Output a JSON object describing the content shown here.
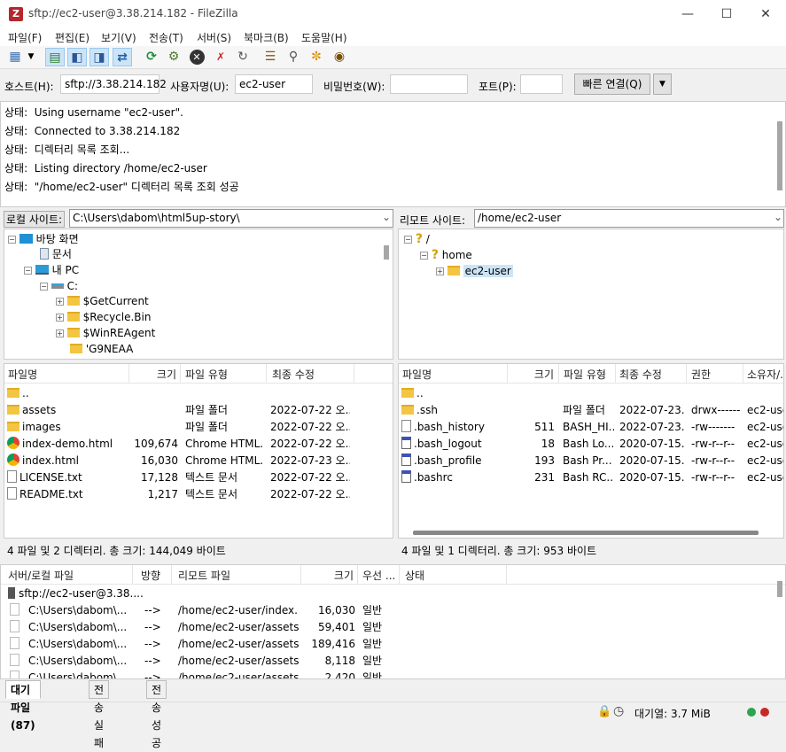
{
  "window": {
    "title": "sftp://ec2-user@3.38.214.182 - FileZilla",
    "app_icon": "Z"
  },
  "menu": [
    "파일(F)",
    "편집(E)",
    "보기(V)",
    "전송(T)",
    "서버(S)",
    "북마크(B)",
    "도움말(H)"
  ],
  "quickconnect": {
    "host_label": "호스트(H):",
    "host_value": "sftp://3.38.214.182",
    "user_label": "사용자명(U):",
    "user_value": "ec2-user",
    "pass_label": "비밀번호(W):",
    "pass_value": "",
    "port_label": "포트(P):",
    "port_value": "",
    "connect_label": "빠른 연결(Q)"
  },
  "log": [
    {
      "prefix": "상태:",
      "text": "Using username \"ec2-user\"."
    },
    {
      "prefix": "상태:",
      "text": "Connected to 3.38.214.182"
    },
    {
      "prefix": "상태:",
      "text": "디렉터리 목록 조회..."
    },
    {
      "prefix": "상태:",
      "text": "Listing directory /home/ec2-user"
    },
    {
      "prefix": "상태:",
      "text": "\"/home/ec2-user\" 디렉터리 목록 조회 성공"
    }
  ],
  "local": {
    "site_label": "로컬 사이트:",
    "site_path": "C:\\Users\\dabom\\html5up-story\\",
    "tree": [
      {
        "label": "바탕 화면",
        "icon": "desktop-icon"
      },
      {
        "label": "문서",
        "icon": "document-icon"
      },
      {
        "label": "내 PC",
        "icon": "computer-icon"
      },
      {
        "label": "C:",
        "icon": "drive-icon"
      },
      {
        "label": "$GetCurrent",
        "icon": "folder-icon"
      },
      {
        "label": "$Recycle.Bin",
        "icon": "folder-icon"
      },
      {
        "label": "$WinREAgent",
        "icon": "folder-icon"
      },
      {
        "label": "'G9NEAA",
        "icon": "folder-icon"
      }
    ],
    "columns": [
      "파일명",
      "크기",
      "파일 유형",
      "최종 수정"
    ],
    "files": [
      {
        "name": "..",
        "size": "",
        "type": "",
        "modified": "",
        "icon": "folder"
      },
      {
        "name": "assets",
        "size": "",
        "type": "파일 폴더",
        "modified": "2022-07-22 오...",
        "icon": "folder"
      },
      {
        "name": "images",
        "size": "",
        "type": "파일 폴더",
        "modified": "2022-07-22 오...",
        "icon": "folder"
      },
      {
        "name": "index-demo.html",
        "size": "109,674",
        "type": "Chrome HTML...",
        "modified": "2022-07-22 오...",
        "icon": "chrome"
      },
      {
        "name": "index.html",
        "size": "16,030",
        "type": "Chrome HTML...",
        "modified": "2022-07-23 오...",
        "icon": "chrome"
      },
      {
        "name": "LICENSE.txt",
        "size": "17,128",
        "type": "텍스트 문서",
        "modified": "2022-07-22 오...",
        "icon": "text"
      },
      {
        "name": "README.txt",
        "size": "1,217",
        "type": "텍스트 문서",
        "modified": "2022-07-22 오...",
        "icon": "text"
      }
    ],
    "status": "4 파일 및 2 디렉터리. 총 크기: 144,049 바이트"
  },
  "remote": {
    "site_label": "리모트 사이트:",
    "site_path": "/home/ec2-user",
    "tree": [
      {
        "label": "/",
        "icon": "question-icon"
      },
      {
        "label": "home",
        "icon": "question-icon"
      },
      {
        "label": "ec2-user",
        "icon": "folder-icon"
      }
    ],
    "columns": [
      "파일명",
      "크기",
      "파일 유형",
      "최종 수정",
      "권한",
      "소유자/..."
    ],
    "files": [
      {
        "name": "..",
        "size": "",
        "type": "",
        "modified": "",
        "perm": "",
        "owner": "",
        "icon": "folder"
      },
      {
        "name": ".ssh",
        "size": "",
        "type": "파일 폴더",
        "modified": "2022-07-23...",
        "perm": "drwx------",
        "owner": "ec2-user",
        "icon": "folder"
      },
      {
        "name": ".bash_history",
        "size": "511",
        "type": "BASH_HI...",
        "modified": "2022-07-23...",
        "perm": "-rw-------",
        "owner": "ec2-user",
        "icon": "text"
      },
      {
        "name": ".bash_logout",
        "size": "18",
        "type": "Bash Lo...",
        "modified": "2020-07-15...",
        "perm": "-rw-r--r--",
        "owner": "ec2-user",
        "icon": "script"
      },
      {
        "name": ".bash_profile",
        "size": "193",
        "type": "Bash Pr...",
        "modified": "2020-07-15...",
        "perm": "-rw-r--r--",
        "owner": "ec2-user",
        "icon": "script"
      },
      {
        "name": ".bashrc",
        "size": "231",
        "type": "Bash RC...",
        "modified": "2020-07-15...",
        "perm": "-rw-r--r--",
        "owner": "ec2-user",
        "icon": "script"
      }
    ],
    "status": "4 파일 및 1 디렉터리. 총 크기: 953 바이트"
  },
  "queue": {
    "columns": [
      "서버/로컬 파일",
      "방향",
      "리모트 파일",
      "크기",
      "우선 ...",
      "상태"
    ],
    "server": "sftp://ec2-user@3.38....",
    "rows": [
      {
        "local": "C:\\Users\\dabom\\...",
        "dir": "-->",
        "remote": "/home/ec2-user/index....",
        "size": "16,030",
        "priority": "일반"
      },
      {
        "local": "C:\\Users\\dabom\\...",
        "dir": "-->",
        "remote": "/home/ec2-user/assets/...",
        "size": "59,401",
        "priority": "일반"
      },
      {
        "local": "C:\\Users\\dabom\\...",
        "dir": "-->",
        "remote": "/home/ec2-user/assets/...",
        "size": "189,416",
        "priority": "일반"
      },
      {
        "local": "C:\\Users\\dabom\\...",
        "dir": "-->",
        "remote": "/home/ec2-user/assets/...",
        "size": "8,118",
        "priority": "일반"
      },
      {
        "local": "C:\\Users\\dabom\\...",
        "dir": "-->",
        "remote": "/home/ec2-user/assets/...",
        "size": "2,420",
        "priority": "일반"
      }
    ]
  },
  "tabs": [
    "대기 파일 (87)",
    "전송 실패",
    "전송 성공"
  ],
  "statusbar": {
    "queue": "대기열: 3.7 MiB"
  },
  "colors": {
    "folder": "#f3c542",
    "selection": "#cce4f7",
    "led_green": "#2da44e",
    "led_red": "#c62828"
  }
}
